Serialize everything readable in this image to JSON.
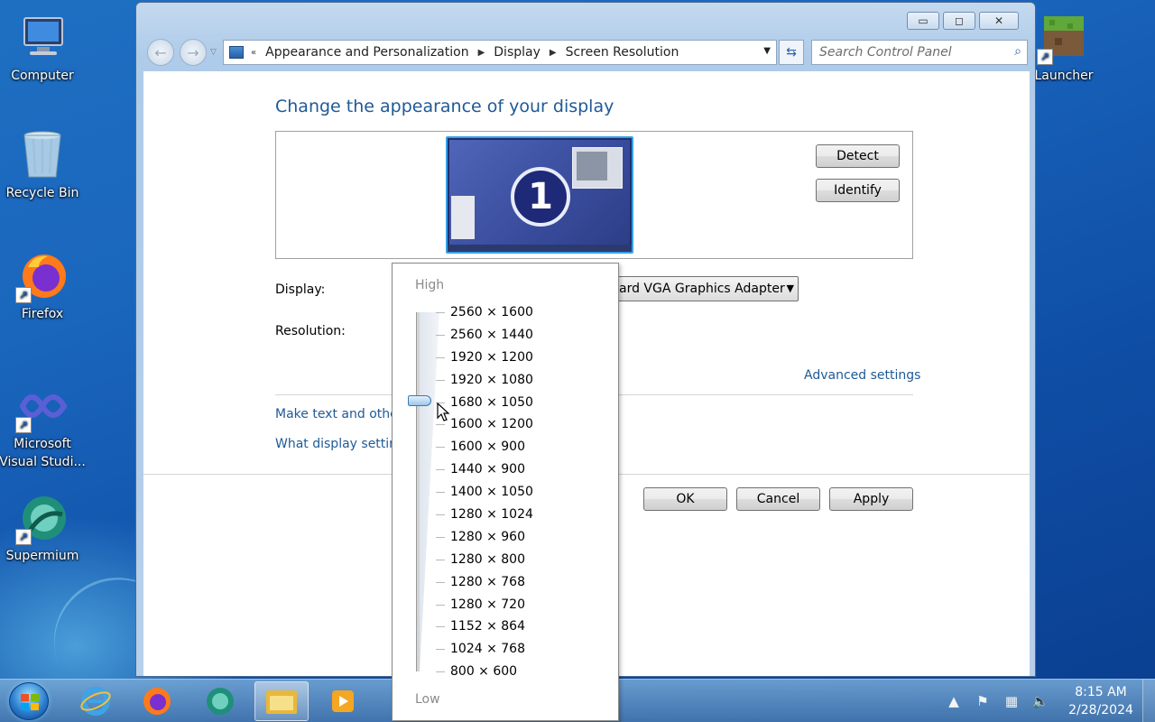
{
  "desktop": {
    "icons": [
      {
        "label": "Computer"
      },
      {
        "label": "Recycle Bin"
      },
      {
        "label": "Firefox"
      },
      {
        "label": "Microsoft Visual Studi..."
      },
      {
        "label": "Supermium"
      },
      {
        "label": "Launcher"
      }
    ]
  },
  "window": {
    "breadcrumb": [
      "Appearance and Personalization",
      "Display",
      "Screen Resolution"
    ],
    "search_placeholder": "Search Control Panel",
    "title": "Change the appearance of your display",
    "monitor_number": "1",
    "detect_label": "Detect",
    "identify_label": "Identify",
    "display_label": "Display:",
    "display_value": "ard VGA Graphics Adapter",
    "resolution_label": "Resolution:",
    "advanced_link": "Advanced settings",
    "link_text_size": "Make text and other",
    "link_display_settings": "What display setting",
    "ok_label": "OK",
    "cancel_label": "Cancel",
    "apply_label": "Apply"
  },
  "resolution_dropdown": {
    "high_label": "High",
    "low_label": "Low",
    "options": [
      "2560 × 1600",
      "2560 × 1440",
      "1920 × 1200",
      "1920 × 1080",
      "1680 × 1050",
      "1600 × 1200",
      "1600 × 900",
      "1440 × 900",
      "1400 × 1050",
      "1280 × 1024",
      "1280 × 960",
      "1280 × 800",
      "1280 × 768",
      "1280 × 720",
      "1152 × 864",
      "1024 × 768",
      "800 × 600"
    ],
    "selected": "1680 × 1050"
  },
  "taskbar": {
    "apps": [
      "internet-explorer",
      "firefox",
      "supermium",
      "file-explorer",
      "media-player"
    ],
    "clock_time": "8:15 AM",
    "clock_date": "2/28/2024"
  },
  "colors": {
    "accent_link": "#1e5a96",
    "desktop_bg": "#1a66bd"
  }
}
